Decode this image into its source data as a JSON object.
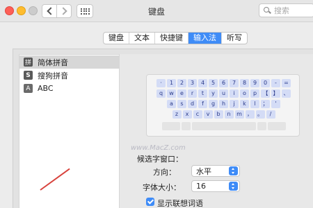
{
  "window": {
    "title": "键盘"
  },
  "search": {
    "placeholder": "搜索"
  },
  "tabs": [
    {
      "label": "键盘"
    },
    {
      "label": "文本"
    },
    {
      "label": "快捷键"
    },
    {
      "label": "输入法",
      "active": true
    },
    {
      "label": "听写"
    }
  ],
  "input_sources": [
    {
      "label": "简体拼音",
      "icon": "拼",
      "selected": true
    },
    {
      "label": "搜狗拼音",
      "icon": "S"
    },
    {
      "label": "ABC",
      "icon": "A"
    }
  ],
  "keyboard": {
    "rows": [
      [
        "·",
        "1",
        "2",
        "3",
        "4",
        "5",
        "6",
        "7",
        "8",
        "9",
        "0",
        "-",
        "="
      ],
      [
        "q",
        "w",
        "e",
        "r",
        "t",
        "y",
        "u",
        "i",
        "o",
        "p",
        "【",
        "】",
        "、"
      ],
      [
        "a",
        "s",
        "d",
        "f",
        "g",
        "h",
        "j",
        "k",
        "l",
        "；",
        "'"
      ],
      [
        "z",
        "x",
        "c",
        "v",
        "b",
        "n",
        "m",
        "，",
        "。",
        "/"
      ]
    ]
  },
  "watermark": "www.MacZ.com",
  "candidate_window": {
    "heading": "候选字窗口：",
    "direction_label": "方向：",
    "direction_value": "水平",
    "font_size_label": "字体大小：",
    "font_size_value": "16",
    "predictive_label": "显示联想词语",
    "predictive_checked": true
  },
  "colors": {
    "accent": "#3f8cf7",
    "annotation": "#d8423c"
  }
}
